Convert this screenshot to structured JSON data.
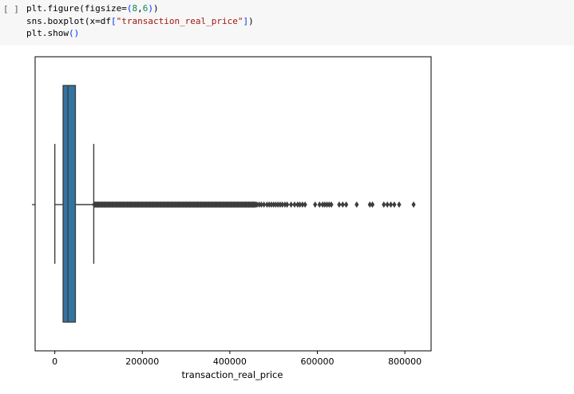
{
  "cell": {
    "prompt": "[ ]",
    "code": {
      "line1": {
        "a": "plt.figure(figsize=",
        "b": "(",
        "c": "8",
        "d": ",",
        "e": "6",
        "f": ")",
        "g": ")"
      },
      "line2": {
        "a": "sns.boxplot(x=df",
        "b": "[",
        "c": "\"transaction_real_price\"",
        "d": "]",
        "e": ")"
      },
      "line3": {
        "a": "plt.show",
        "b": "()"
      }
    }
  },
  "chart_data": {
    "type": "box",
    "title": "",
    "xlabel": "transaction_real_price",
    "ylabel": "",
    "xlim": [
      -45000,
      860000
    ],
    "xticks": [
      0,
      200000,
      400000,
      600000,
      800000
    ],
    "xtick_labels": [
      "0",
      "200000",
      "400000",
      "600000",
      "800000"
    ],
    "box": {
      "whisker_low": 0,
      "q1": 19000,
      "median": 30000,
      "q3": 47000,
      "whisker_high": 89000,
      "color": "#3274a1"
    },
    "outliers_dense": [
      90000,
      460000
    ],
    "outliers": [
      462000,
      467000,
      472000,
      478000,
      485000,
      490000,
      495000,
      500000,
      505000,
      510000,
      515000,
      520000,
      526000,
      531000,
      540000,
      548000,
      555000,
      560000,
      566000,
      572000,
      595000,
      605000,
      612000,
      617000,
      622000,
      627000,
      632000,
      650000,
      658000,
      666000,
      690000,
      720000,
      726000,
      752000,
      760000,
      768000,
      776000,
      787000,
      820000
    ],
    "outlier_color": "#3d3d3d"
  }
}
